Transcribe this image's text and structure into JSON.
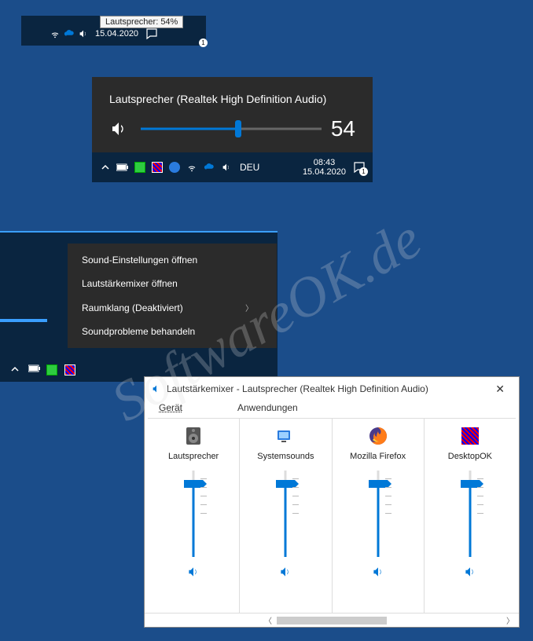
{
  "watermark": "SoftwareOK.de",
  "tooltip": {
    "text": "Lautsprecher: 54%"
  },
  "tray1": {
    "date": "15.04.2020",
    "notif_count": "1"
  },
  "volume_flyout": {
    "device_name": "Lautsprecher (Realtek High Definition Audio)",
    "level": 54,
    "level_text": "54"
  },
  "tray2": {
    "lang": "DEU",
    "time": "08:43",
    "date": "15.04.2020",
    "notif_count": "1"
  },
  "context_menu": {
    "items": [
      {
        "label": "Sound-Einstellungen öffnen",
        "submenu": false
      },
      {
        "label": "Lautstärkemixer öffnen",
        "submenu": false
      },
      {
        "label": "Raumklang (Deaktiviert)",
        "submenu": true
      },
      {
        "label": "Soundprobleme behandeln",
        "submenu": false
      }
    ]
  },
  "mixer": {
    "title": "Lautstärkemixer - Lautsprecher (Realtek High Definition Audio)",
    "header_device": "Gerät",
    "header_apps": "Anwendungen",
    "columns": [
      {
        "name": "Lautsprecher",
        "icon": "speaker-device-icon",
        "level": 85
      },
      {
        "name": "Systemsounds",
        "icon": "system-sounds-icon",
        "level": 85
      },
      {
        "name": "Mozilla Firefox",
        "icon": "firefox-icon",
        "level": 85
      },
      {
        "name": "DesktopOK",
        "icon": "desktopok-icon",
        "level": 85
      }
    ]
  }
}
